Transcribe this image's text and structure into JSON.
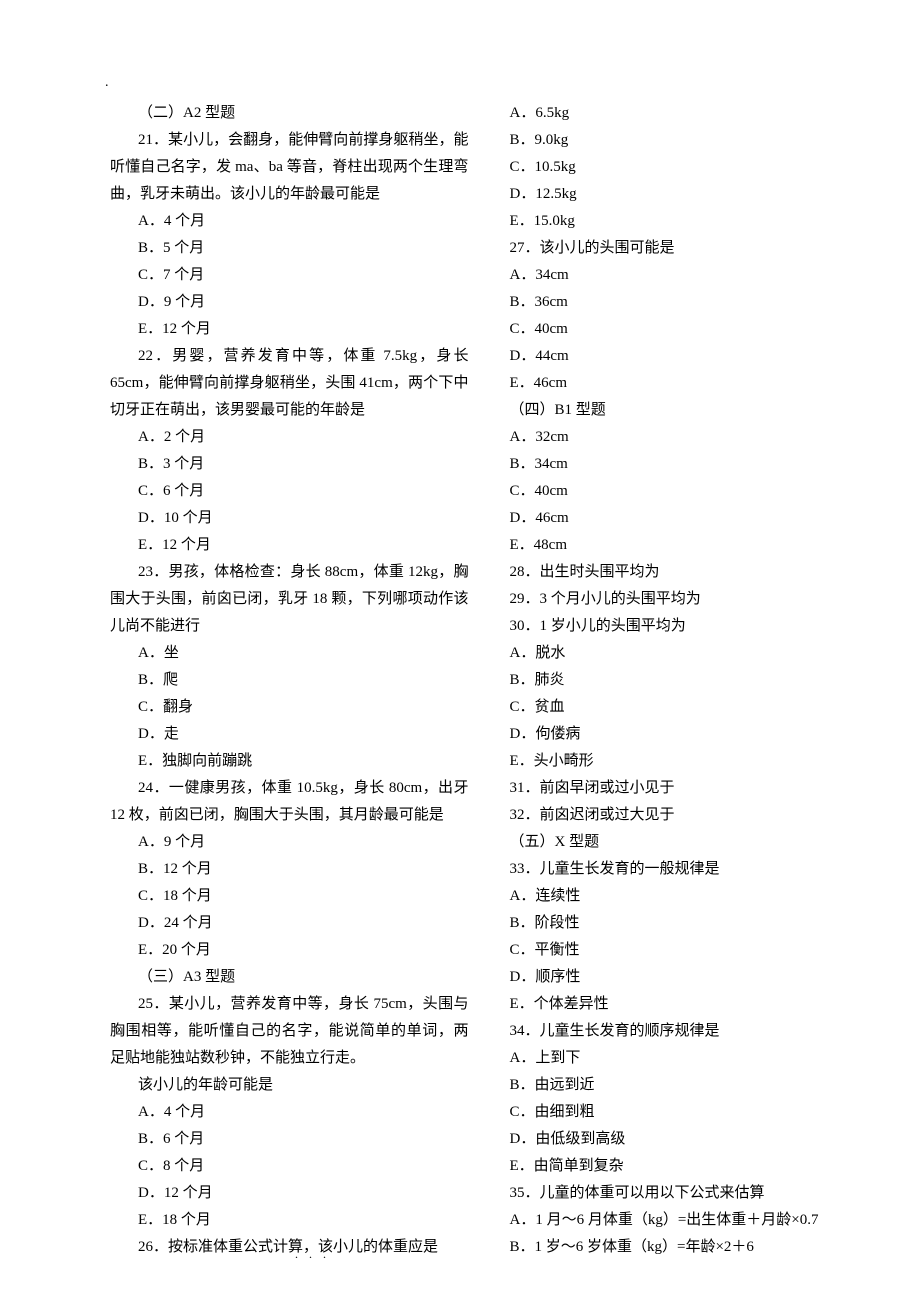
{
  "dot": ".",
  "footer": ". . .",
  "left": {
    "sec2": "（二）A2 型题",
    "q21": "21．某小儿，会翻身，能伸臂向前撑身躯稍坐，能听懂自己名字，发 ma、ba 等音，脊柱出现两个生理弯曲，乳牙未萌出。该小儿的年龄最可能是",
    "q21a": "A．4 个月",
    "q21b": "B．5 个月",
    "q21c": "C．7 个月",
    "q21d": "D．9 个月",
    "q21e": "E．12 个月",
    "q22": "22．男婴，营养发育中等，体重 7.5kg，身长 65cm，能伸臂向前撑身躯稍坐，头围 41cm，两个下中切牙正在萌出，该男婴最可能的年龄是",
    "q22a": "A．2 个月",
    "q22b": "B．3 个月",
    "q22c": "C．6 个月",
    "q22d": "D．10 个月",
    "q22e": "E．12 个月",
    "q23": "23．男孩，体格检查：身长 88cm，体重 12kg，胸围大于头围，前囟已闭，乳牙 18 颗，下列哪项动作该儿尚不能进行",
    "q23a": "A．坐",
    "q23b": "B．爬",
    "q23c": "C．翻身",
    "q23d": "D．走",
    "q23e": "E．独脚向前蹦跳",
    "q24": "24．一健康男孩，体重 10.5kg，身长 80cm，出牙 12 枚，前囟已闭，胸围大于头围，其月龄最可能是",
    "q24a": "A．9 个月",
    "q24b": "B．12 个月",
    "q24c": "C．18 个月",
    "q24d": "D．24 个月",
    "q24e": "E．20 个月",
    "sec3": "（三）A3 型题",
    "q25": "25．某小儿，营养发育中等，身长 75cm，头围与胸围相等，能听懂自己的名字，能说简单的单词，两足贴地能独站数秒钟，不能独立行走。",
    "q25q": "该小儿的年龄可能是",
    "q25a": "A．4 个月",
    "q25b": "B．6 个月",
    "q25c": "C．8 个月",
    "q25d": "D．12 个月",
    "q25e": "E．18 个月",
    "q26": "26．按标准体重公式计算，该小儿的体重应是"
  },
  "right": {
    "q26a": "A．6.5kg",
    "q26b": "B．9.0kg",
    "q26c": "C．10.5kg",
    "q26d": "D．12.5kg",
    "q26e": "E．15.0kg",
    "q27": "27．该小儿的头围可能是",
    "q27a": "A．34cm",
    "q27b": "B．36cm",
    "q27c": "C．40cm",
    "q27d": "D．44cm",
    "q27e": "E．46cm",
    "sec4": "（四）B1 型题",
    "b4a": "A．32cm",
    "b4b": "B．34cm",
    "b4c": "C．40cm",
    "b4d": "D．46cm",
    "b4e": "E．48cm",
    "q28": "28．出生时头围平均为",
    "q29": "29．3 个月小儿的头围平均为",
    "q30": "30．1 岁小儿的头围平均为",
    "g3a": "A．脱水",
    "g3b": "B．肺炎",
    "g3c": "C．贫血",
    "g3d": "D．佝偻病",
    "g3e": "E．头小畸形",
    "q31": "31．前囟早闭或过小见于",
    "q32": "32．前囟迟闭或过大见于",
    "sec5": "（五）X 型题",
    "q33": "33．儿童生长发育的一般规律是",
    "q33a": "A．连续性",
    "q33b": "B．阶段性",
    "q33c": "C．平衡性",
    "q33d": "D．顺序性",
    "q33e": "E．个体差异性",
    "q34": "34．儿童生长发育的顺序规律是",
    "q34a": "A．上到下",
    "q34b": "B．由远到近",
    "q34c": "C．由细到粗",
    "q34d": "D．由低级到高级",
    "q34e": "E．由简单到复杂",
    "q35": "35．儿童的体重可以用以下公式来估算",
    "q35a": "A．1 月～6 月体重（kg）=出生体重＋月龄×0.7",
    "q35b": "B．1 岁～6 岁体重（kg）=年龄×2＋6"
  }
}
